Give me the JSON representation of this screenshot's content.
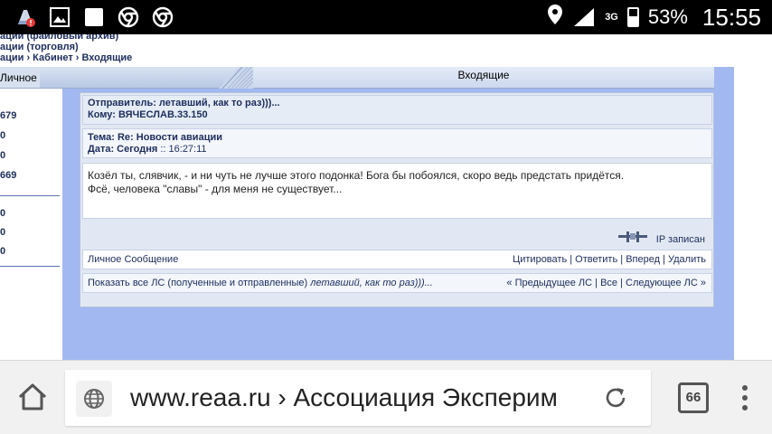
{
  "status_bar": {
    "battery_percent": "53%",
    "battery_level": 0.53,
    "network": "3G",
    "time": "15:55",
    "icons": [
      "app-update-icon",
      "gallery-icon",
      "blank-app-icon",
      "chrome-icon",
      "chrome-icon",
      "location-icon",
      "signal-icon",
      "battery-icon"
    ]
  },
  "page": {
    "breadcrumbs": [
      "ации (файловый архив)",
      "ации (торговля)",
      "ации › Кабинет › Входящие"
    ],
    "tabs": {
      "personal": "Личное",
      "inbox": "Входящие"
    },
    "sidebar_stats": [
      "679",
      "0",
      "0",
      "669",
      "0",
      "0",
      "0"
    ],
    "message": {
      "sender": "Отправитель: летавший, как то раз)))...",
      "recipient": "Кому: ВЯЧЕСЛАВ.33.150",
      "subject": "Тема: Re: Новости авиации",
      "date_label": "Дата: Сегодня",
      "date_time": " :: 16:27:11",
      "body_line1": "Козёл ты, слявчик, - и ни чуть не лучше этого подонка! Бога бы побоялся, скоро ведь предстать придётся.",
      "body_line2": "Фсё, человека \"славы\" - для меня не существует...",
      "ip_label": "IP записан"
    },
    "actions": {
      "personal_message": "Личное Сообщение",
      "quote": "Цитировать",
      "reply": "Ответить",
      "forward": "Вперед",
      "delete": "Удалить",
      "separator": " | "
    },
    "show_all": {
      "prefix": "Показать все ЛС (полученные и отправленные) ",
      "user": "летавший, как то раз)))...",
      "prev": "« Предыдущее ЛС",
      "all": "Все",
      "next": "Следующее ЛС »"
    }
  },
  "browser": {
    "url": "www.reaa.ru › Ассоциация Эксперим",
    "tab_count": "66"
  }
}
